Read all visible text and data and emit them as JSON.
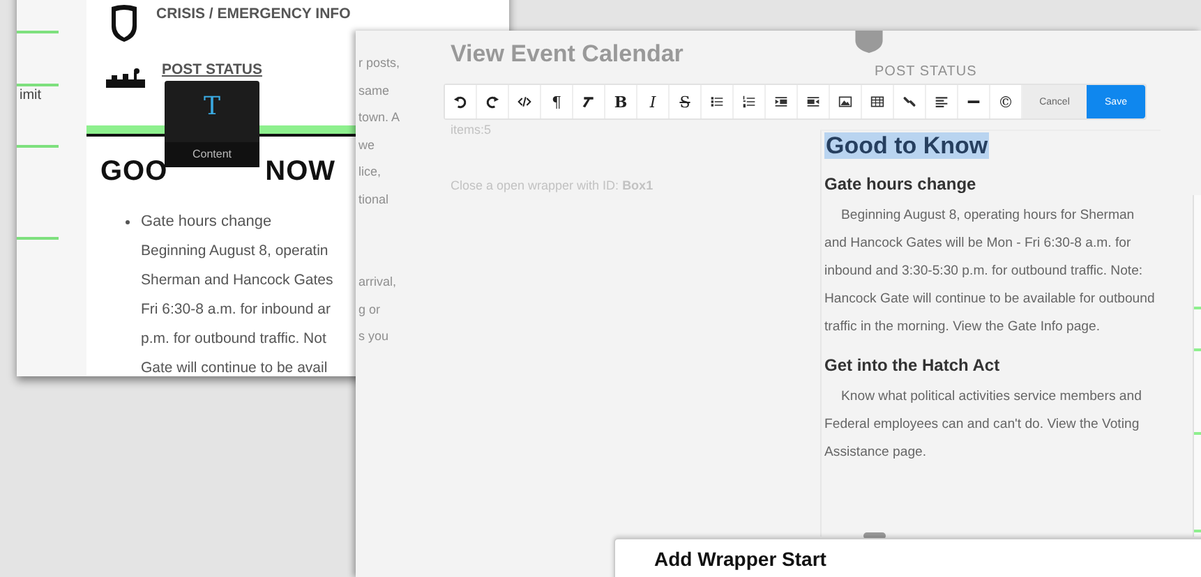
{
  "left_page": {
    "sidebar_text": "imit",
    "nav": [
      {
        "label": "CRISIS / EMERGENCY INFO"
      },
      {
        "label": "POST STATUS"
      }
    ],
    "heading_parts": [
      "GOO",
      "NOW"
    ],
    "list_item": "Gate hours change",
    "paragraph_lines": [
      "Beginning August 8, operatin",
      "Sherman and Hancock Gates",
      "Fri 6:30-8 a.m. for inbound ar",
      "p.m. for outbound traffic. Not",
      "Gate will continue to be avail"
    ]
  },
  "tooltip": {
    "glyph": "T",
    "label": "Content"
  },
  "editor_window": {
    "title": "View Event Calendar",
    "toolbar": {
      "glyphs": [
        "¶",
        "B",
        "I",
        "S",
        "©"
      ],
      "cancel": "Cancel",
      "save": "Save"
    },
    "items_count": "items:5",
    "note": "Close a open wrapper with ID: **Box1**",
    "behind_text_top": [
      "r posts,",
      "same",
      "town. A",
      "we",
      "lice,",
      "tional"
    ],
    "behind_text_bottom": [
      "arrival,",
      "g or",
      "s you"
    ],
    "behind_nav": "POST STATUS",
    "preview": {
      "heading": "Good to Know",
      "heading_selected": true,
      "sections": [
        {
          "title": "Gate hours change",
          "body": "Beginning August 8, operating hours for Sherman and Hancock Gates will be Mon - Fri 6:30-8 a.m. for inbound and 3:30-5:30 p.m. for outbound traffic. Note: Hancock Gate will continue to be available for outbound traffic in the morning. View the Gate Info page."
        },
        {
          "title": "Get into the Hatch Act",
          "body": "Know what political activities service members and Federal employees can and can't do. View the Voting Assistance page."
        }
      ]
    }
  },
  "dialog": {
    "title": "Add Wrapper Start"
  }
}
